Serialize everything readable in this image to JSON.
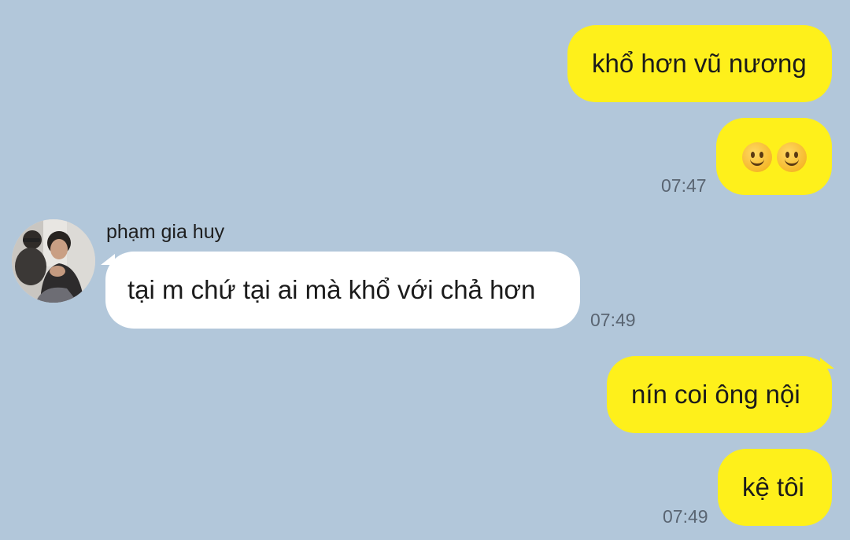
{
  "messages": [
    {
      "direction": "out",
      "text": "khổ hơn vũ nương",
      "time": ""
    },
    {
      "direction": "out",
      "text": "🙂🙂",
      "emoji": [
        "slightly-smiling-face",
        "slightly-smiling-face"
      ],
      "time": "07:47"
    },
    {
      "direction": "in",
      "sender": "phạm gia huy",
      "text": "tại m chứ tại ai mà khổ với chả hơn",
      "time": "07:49"
    },
    {
      "direction": "out",
      "text": "nín coi ông nội",
      "time": ""
    },
    {
      "direction": "out",
      "text": "kệ tôi",
      "time": "07:49"
    }
  ],
  "colors": {
    "background": "#b2c7da",
    "outgoing_bubble": "#fef01b",
    "incoming_bubble": "#ffffff",
    "timestamp": "#5a6572"
  }
}
